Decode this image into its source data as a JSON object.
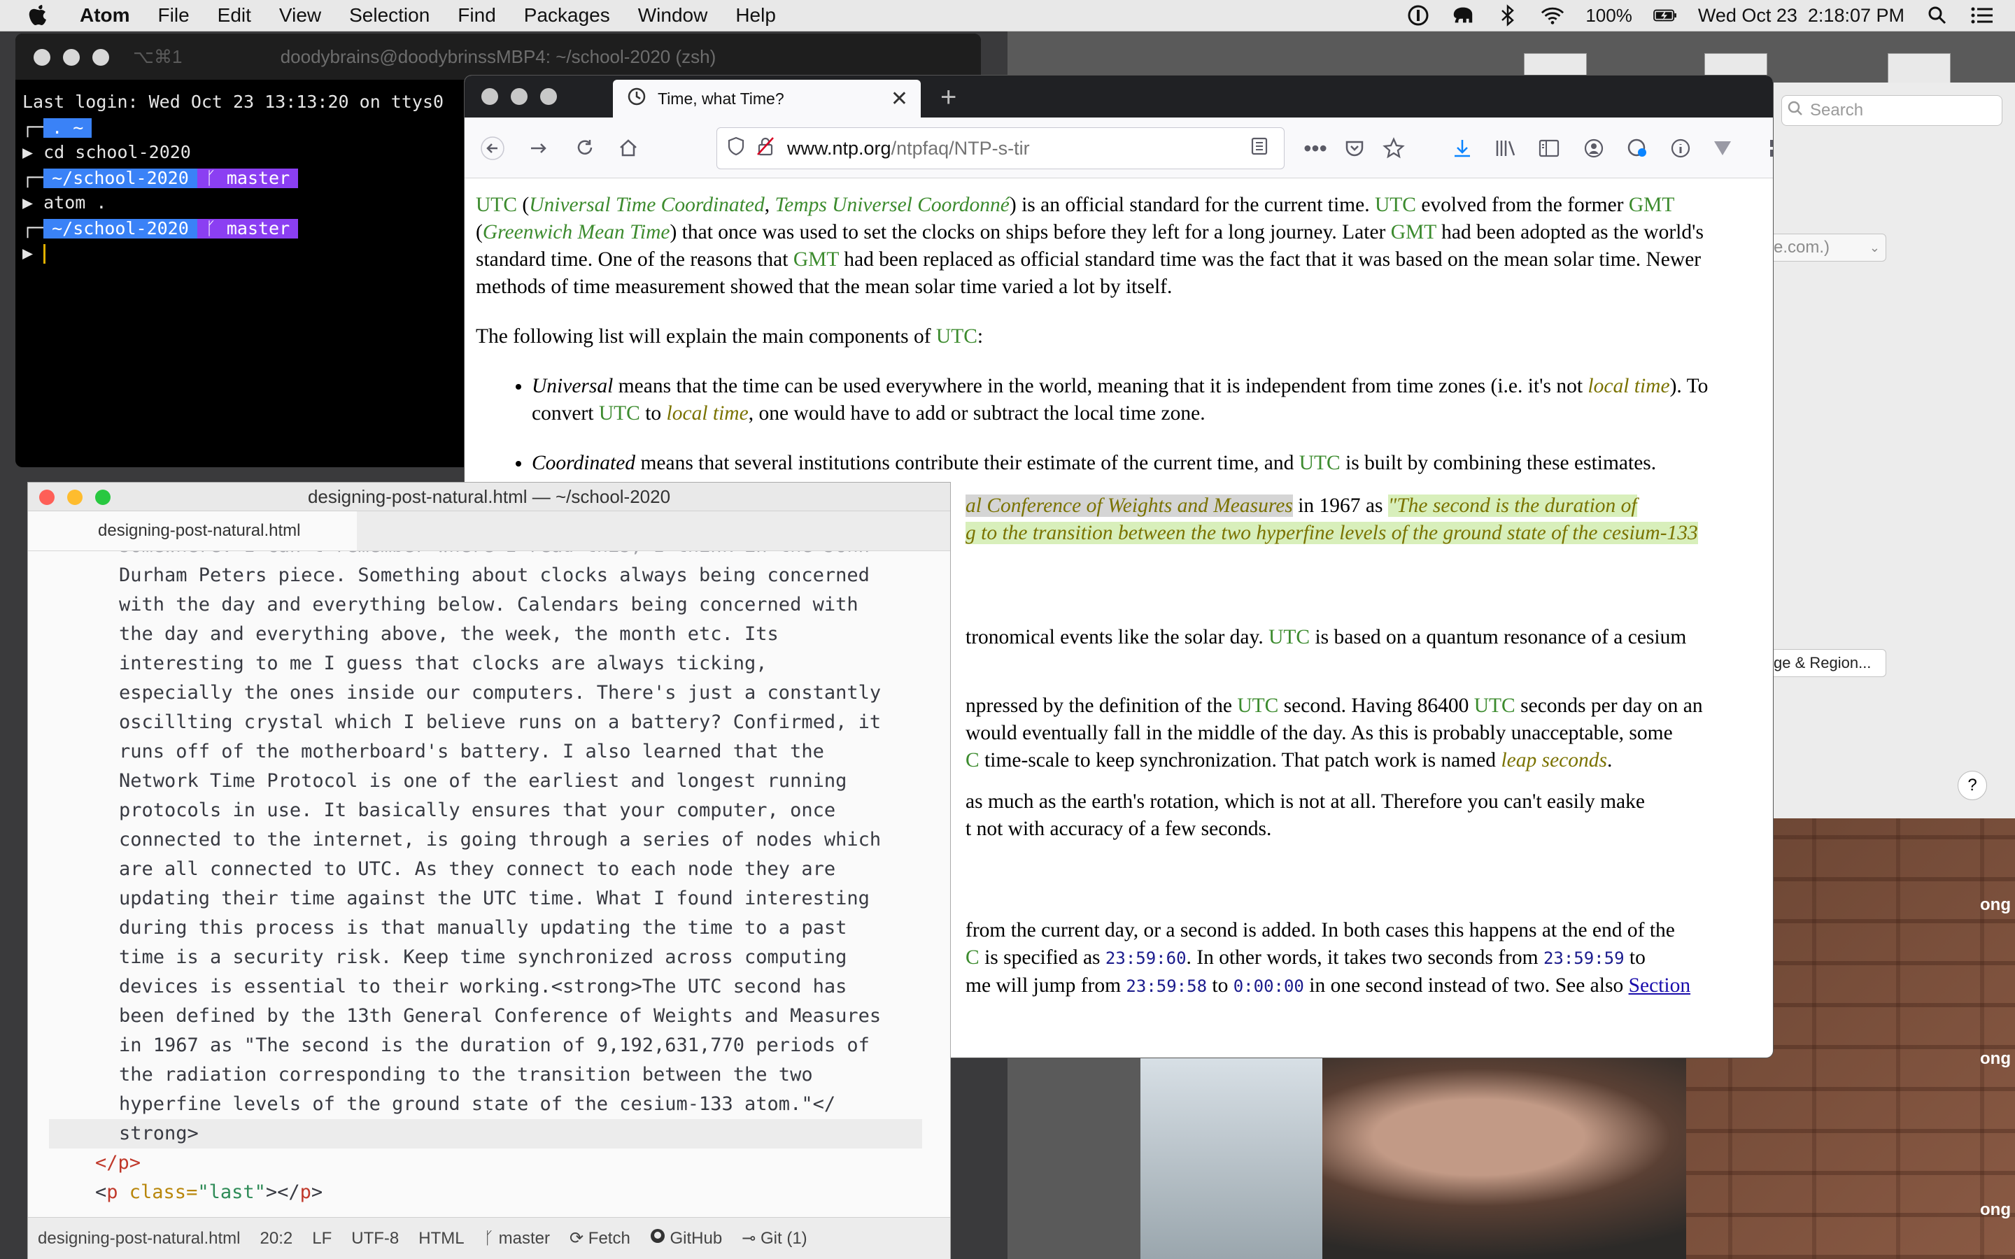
{
  "menubar": {
    "app_name": "Atom",
    "menus": [
      "File",
      "Edit",
      "View",
      "Selection",
      "Find",
      "Packages",
      "Window",
      "Help"
    ],
    "battery": "100%",
    "clock": "Wed Oct 23  2:18:07 PM"
  },
  "terminal": {
    "shortcut": "⌥⌘1",
    "title": "doodybrains@doodybrinssMBP4: ~/school-2020 (zsh)",
    "last_login": "Last login: Wed Oct 23 13:13:20 on ttys0",
    "prompt1_dir": ". ~",
    "cmd1": "cd school-2020",
    "prompt2_dir": "~/school-2020",
    "branch": "master",
    "cmd2": "atom .",
    "prompt3_dir": "~/school-2020",
    "prompt_symbol": "▶"
  },
  "firefox": {
    "tab_title": "Time, what Time?",
    "url_domain": "www.ntp.org",
    "url_path": "/ntpfaq/NTP-s-tir",
    "content": {
      "p1": {
        "utc": "UTC",
        "utc_long": "Universal Time Coordinated",
        "utc_fr": "Temps Universel Coordonné",
        "t1": ") is an official standard for the current time. ",
        "t2": " evolved from the former ",
        "gmt": "GMT",
        "gmt_long": "Greenwich Mean Time",
        "t3": ") that once was used to set the clocks on ships before they left for a long journey. Later ",
        "t4": " had been adopted as the world's standard time. One of the reasons that ",
        "t5": " had been replaced as official standard time was the fact that it was based on the mean solar time. Newer methods of time measurement showed that the mean solar time varied a lot by itself."
      },
      "p2": "The following list will explain the main components of ",
      "li1": {
        "word": "Universal",
        "t1": " means that the time can be used everywhere in the world, meaning that it is independent from time zones (i.e. it's not ",
        "local_time": "local time",
        "t2": "). To convert ",
        "t3": " to ",
        "t4": ", one would have to add or subtract the local time zone."
      },
      "li2": {
        "word": "Coordinated",
        "t1": " means that several institutions contribute their estimate of the current time, and ",
        "t2": " is built by combining these estimates."
      },
      "frag1": {
        "conf": "al Conference of Weights and Measures",
        "t1": " in 1967 as ",
        "quote": "\"The second is the duration of",
        "line2": "g to the transition between the two hyperfine levels of the ground state of the cesium-133"
      },
      "frag2": {
        "t1": "tronomical events like the solar day. ",
        "t2": " is based on a quantum resonance of a cesium"
      },
      "frag3": {
        "a1": "npressed by the definition of the ",
        "a2": " second. Having 86400 ",
        "a3": " seconds per day on an",
        "b1": " would eventually fall in the middle of the day. As this is probably unacceptable, some",
        "c_utc": "C",
        "c1": " time-scale to keep synchronization. That patch work is named ",
        "leap": "leap seconds",
        "c2": "."
      },
      "frag4": {
        "l1": " as much as the earth's rotation, which is not at all. Therefore you can't easily make",
        "l2": "t not with accuracy of a few seconds."
      },
      "frag5": {
        "l1": "from the current day, or a second is added. In both cases this happens at the end of the",
        "c_utc": "C",
        "s1": " is specified as ",
        "code1": "23:59:60",
        "s2": ". In other words, it takes two seconds from ",
        "code2": "23:59:59",
        "s3": " to",
        "m1": "me will jump from ",
        "code3": "23:59:58",
        "m2": " to ",
        "code4": "0:00:00",
        "m3": " in one second instead of two. See also ",
        "section": "Section"
      }
    }
  },
  "atom": {
    "title": "designing-post-natural.html — ~/school-2020",
    "tab": "designing-post-natural.html",
    "lines": [
      "somewhere. I can't remember where I read this, I think in the John",
      "Durham Peters piece. Something about clocks always being concerned",
      "with the day and everything below. Calendars being concerned with",
      "the day and everything above, the week, the month etc. Its",
      "interesting to me I guess that clocks are always ticking,",
      "especially the ones inside our computers. There's just a constantly",
      "oscillting crystal which I believe runs on a battery? Confirmed, it",
      "runs off of the motherboard's battery. I also learned that the",
      "Network Time Protocol is one of the earliest and longest running",
      "protocols in use. It basically ensures that your computer, once",
      "connected to the internet, is going through a series of nodes which",
      "are all connected to UTC. As they connect to each node they are",
      "updating their time against the UTC time. What I found interesting",
      "during this process is that manually updating the time to a past",
      "time is a security risk. Keep time synchronized across computing",
      "devices is essential to their working.<strong>The UTC second has",
      "been defined by the 13th General Conference of Weights and Measures",
      "in 1967 as \"The second is the duration of 9,192,631,770 periods of",
      "the radiation corresponding to the transition between the two",
      "hyperfine levels of the ground state of the cesium-133 atom.\"</",
      "strong>"
    ],
    "closing_p": "</p>",
    "last_p": {
      "open": "<",
      "tag": "p",
      "attr": " class=",
      "val": "\"last\"",
      "close": "></",
      "tag2": "p",
      "end": ">"
    },
    "status": {
      "file": "designing-post-natural.html",
      "position": "20:2",
      "line_ending": "LF",
      "encoding": "UTF-8",
      "grammar": "HTML",
      "branch": "master",
      "fetch": "Fetch",
      "github": "GitHub",
      "git": "Git (1)"
    }
  },
  "prefs": {
    "search_placeholder": "Search",
    "select_text": "e.com.)",
    "region_button": "ge & Region...",
    "help": "?"
  },
  "video": {
    "label": "ong"
  },
  "colors": {
    "utc_green": "#3c8b2e",
    "olive_italic": "#7a7200",
    "term_dir_blue": "#3a82f7",
    "term_branch_purple": "#8b3ff2"
  }
}
